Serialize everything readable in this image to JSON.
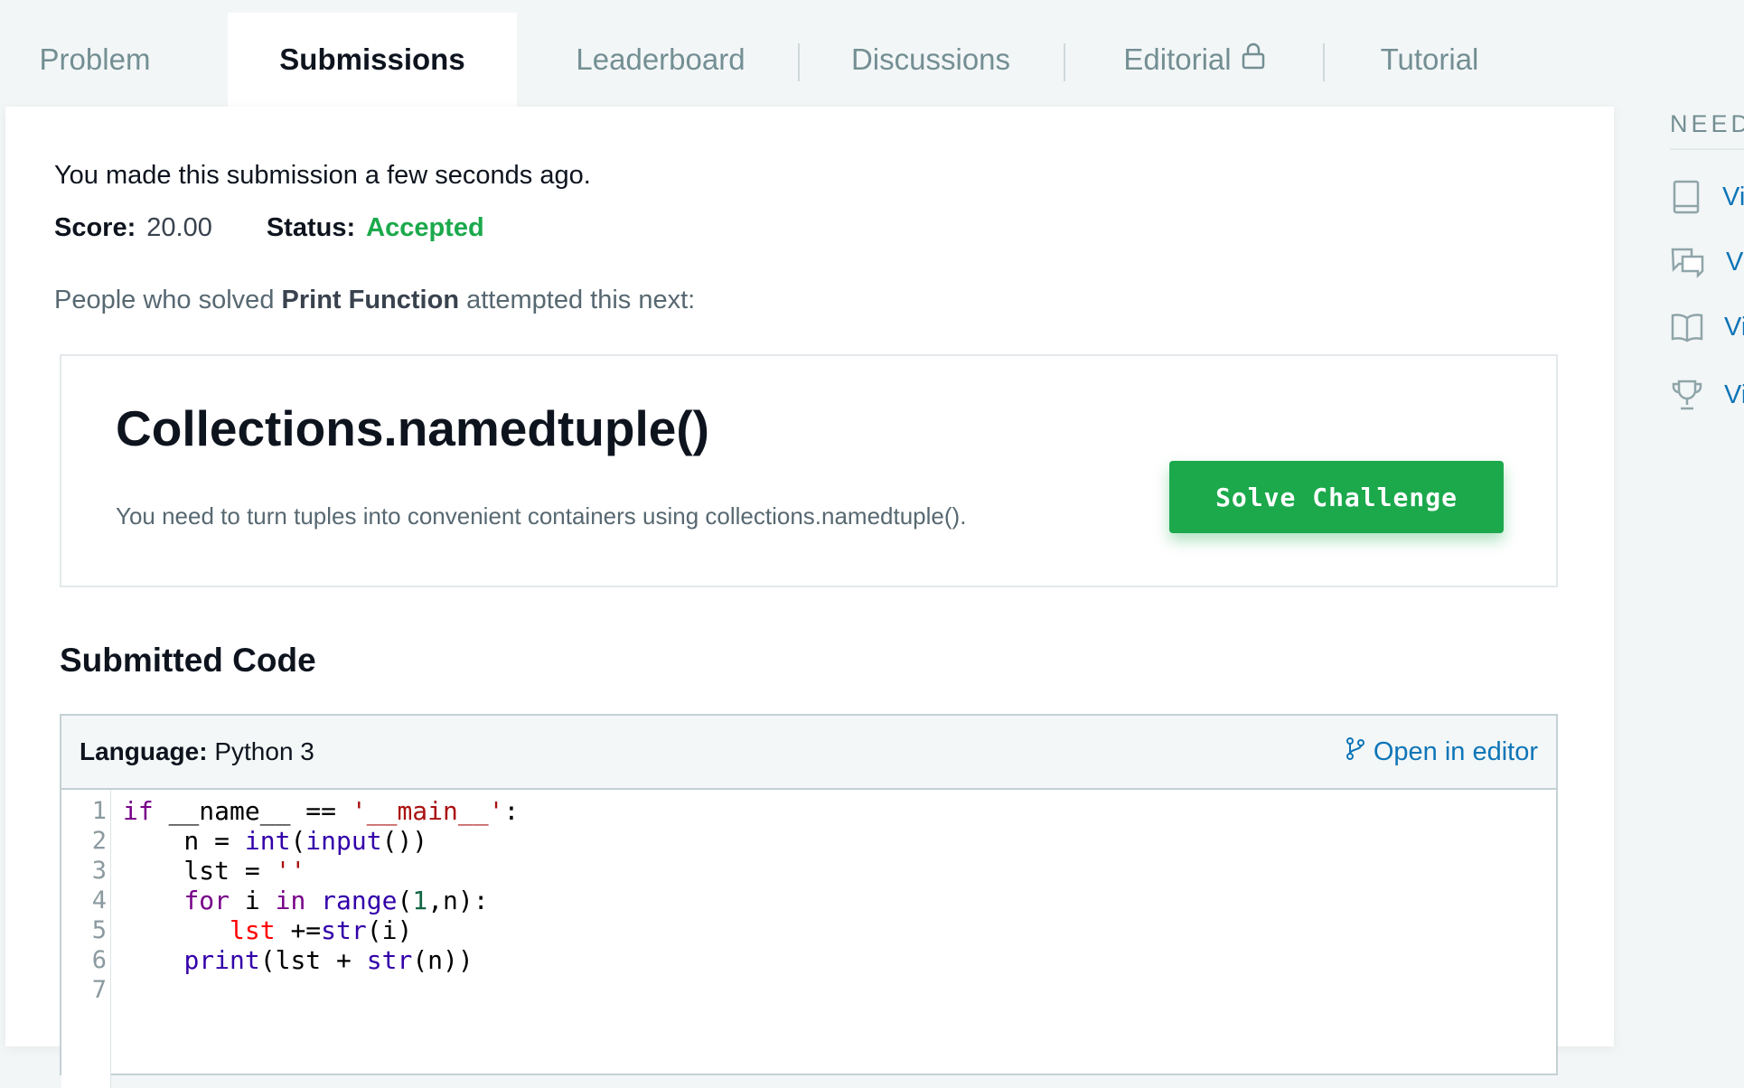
{
  "tabs": {
    "problem": "Problem",
    "submissions": "Submissions",
    "leaderboard": "Leaderboard",
    "discussions": "Discussions",
    "editorial": "Editorial",
    "tutorial": "Tutorial"
  },
  "submission": {
    "made_text": "You made this submission a few seconds ago.",
    "score_label": "Score:",
    "score_value": "20.00",
    "status_label": "Status:",
    "status_value": "Accepted",
    "people_prefix": "People who solved",
    "people_problem": "Print Function",
    "people_suffix": "attempted this next:"
  },
  "next_challenge": {
    "title": "Collections.namedtuple()",
    "description": "You need to turn tuples into convenient containers using collections.namedtuple().",
    "button": "Solve Challenge"
  },
  "code": {
    "heading": "Submitted Code",
    "language_label": "Language:",
    "language_value": "Python 3",
    "open_editor": "Open in editor",
    "line_numbers": [
      "1",
      "2",
      "3",
      "4",
      "5",
      "6",
      "7"
    ]
  },
  "sidebar": {
    "title": "NEED",
    "items": [
      "Vi",
      "Vi",
      "Vi",
      "Vi"
    ]
  },
  "colors": {
    "accent_green": "#1ba94c",
    "link_blue": "#0e75b8"
  }
}
